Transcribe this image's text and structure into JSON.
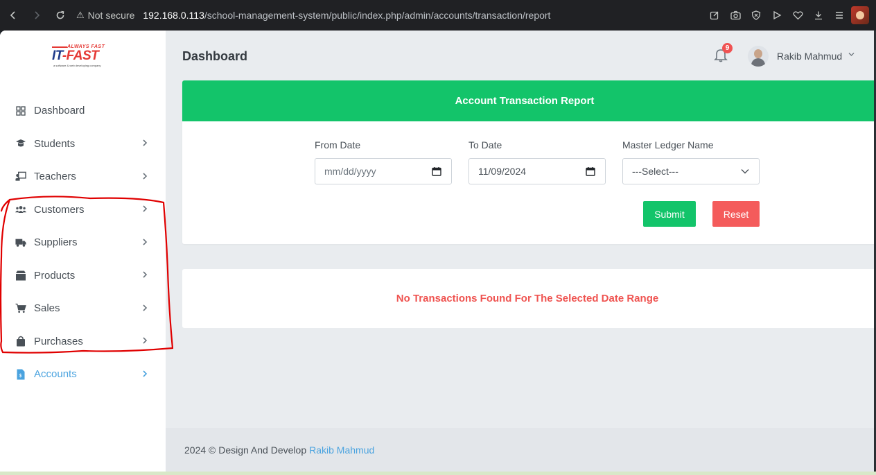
{
  "browser": {
    "security_label": "Not secure",
    "url_host": "192.168.0.113",
    "url_path": "/school-management-system/public/index.php/admin/accounts/transaction/report"
  },
  "logo": {
    "tagline": "ALWAYS FAST",
    "brand_a": "IT",
    "brand_b": "-FAST",
    "sub": "a software & web developing company"
  },
  "sidebar": {
    "items": [
      {
        "label": "Dashboard",
        "icon": "dashboard-icon",
        "has_chevron": false
      },
      {
        "label": "Students",
        "icon": "graduation-cap-icon",
        "has_chevron": true
      },
      {
        "label": "Teachers",
        "icon": "chalkboard-teacher-icon",
        "has_chevron": true
      },
      {
        "label": "Customers",
        "icon": "users-icon",
        "has_chevron": true
      },
      {
        "label": "Suppliers",
        "icon": "truck-icon",
        "has_chevron": true
      },
      {
        "label": "Products",
        "icon": "box-icon",
        "has_chevron": true
      },
      {
        "label": "Sales",
        "icon": "cart-icon",
        "has_chevron": true
      },
      {
        "label": "Purchases",
        "icon": "shopping-bag-icon",
        "has_chevron": true
      },
      {
        "label": "Accounts",
        "icon": "invoice-icon",
        "has_chevron": true,
        "active": true
      }
    ]
  },
  "header": {
    "title": "Dashboard",
    "notification_count": "9",
    "user_name": "Rakib Mahmud"
  },
  "report": {
    "title": "Account Transaction Report",
    "from_date_label": "From Date",
    "from_date_placeholder": "mm/dd/yyyy",
    "to_date_label": "To Date",
    "to_date_value": "11/09/2024",
    "ledger_label": "Master Ledger Name",
    "ledger_selected": "---Select---",
    "submit_label": "Submit",
    "reset_label": "Reset"
  },
  "result": {
    "message": "No Transactions Found For The Selected Date Range"
  },
  "footer": {
    "text": "2024 © Design And Develop",
    "author": "Rakib Mahmud"
  },
  "colors": {
    "accent_green": "#13c46a",
    "danger_red": "#f45b5b",
    "link_blue": "#4aa3df",
    "annotation_red": "#e00000"
  }
}
